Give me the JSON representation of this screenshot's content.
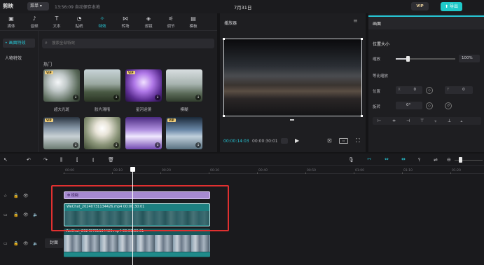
{
  "topbar": {
    "logo": "剪映",
    "menu_label": "菜单 ▾",
    "autosave": "13:56:09 自动保存本地",
    "title": "7月31日",
    "vip": "VIP",
    "export_label": "⬆ 导出"
  },
  "tool_tabs": [
    {
      "label": "媒体",
      "icon": "media-icon",
      "glyph": "▣"
    },
    {
      "label": "音频",
      "icon": "audio-icon",
      "glyph": "♪"
    },
    {
      "label": "文本",
      "icon": "text-icon",
      "glyph": "T"
    },
    {
      "label": "贴纸",
      "icon": "sticker-icon",
      "glyph": "◔"
    },
    {
      "label": "特效",
      "icon": "effects-icon",
      "glyph": "✧",
      "active": true
    },
    {
      "label": "转场",
      "icon": "transition-icon",
      "glyph": "⋈"
    },
    {
      "label": "滤镜",
      "icon": "filter-icon",
      "glyph": "◈"
    },
    {
      "label": "调节",
      "icon": "adjust-icon",
      "glyph": "⚟"
    },
    {
      "label": "模板",
      "icon": "template-icon",
      "glyph": "▤"
    }
  ],
  "side_nav": [
    {
      "label": "• 画面特效",
      "active": true
    },
    {
      "label": "人物特效",
      "active": false
    }
  ],
  "search": {
    "placeholder": "搜索全部特效"
  },
  "section_hot": "热门",
  "effects": [
    {
      "label": "超大光斑",
      "vip": true
    },
    {
      "label": "胶片滑稽",
      "vip": false
    },
    {
      "label": "星河运镜",
      "vip": true
    },
    {
      "label": "模糊",
      "vip": false
    },
    {
      "label": "",
      "vip": true
    },
    {
      "label": "",
      "vip": false
    },
    {
      "label": "",
      "vip": false
    },
    {
      "label": "",
      "vip": true
    }
  ],
  "player": {
    "title": "播放器",
    "time_current": "00:00:14:03",
    "time_total": "00:00:30:01"
  },
  "properties": {
    "tab": "画面",
    "section": "位置大小",
    "scale_label": "缩放",
    "scale_value": "100%",
    "scale_fraction": 0.2,
    "uniform_label": "等比缩放",
    "position_label": "位置",
    "pos_x_prefix": "X",
    "pos_x": "0",
    "pos_y_prefix": "Y",
    "pos_y": "0",
    "rotate_label": "旋转",
    "rotate": "0°"
  },
  "timeline": {
    "ticks": [
      "00:00",
      "00:10",
      "00:20",
      "00:30",
      "00:40",
      "00:50",
      "01:00",
      "01:10",
      "01:20"
    ],
    "effect_clip": "✿ 模糊",
    "clip1": "WeChat_20240731134426.mp4   00:00:30:01",
    "clip2": "WeChat_20240731134426.mp4   00:00:30:01",
    "cover": "封面"
  }
}
